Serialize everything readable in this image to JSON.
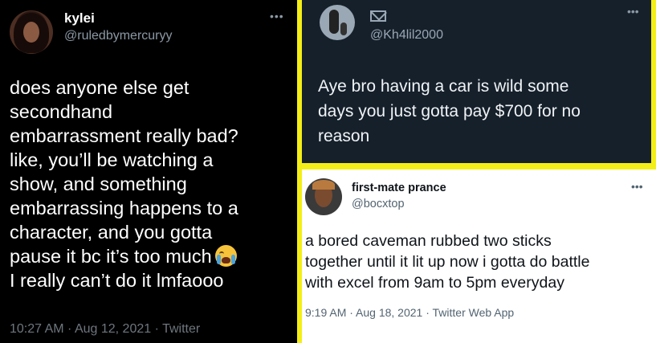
{
  "left_tweet": {
    "name": "kylei",
    "handle": "@ruledbymercuryy",
    "more_icon": "•••",
    "lines": [
      "does anyone else get",
      "secondhand",
      "embarrassment really bad?",
      "like, you’ll be watching a",
      "show, and something",
      "embarrassing happens to a",
      "character, and you gotta",
      "pause it bc it’s too much",
      "I really can’t do it lmfaooo"
    ],
    "emoji": "loudly-crying-face-icon",
    "timestamp": "10:27 AM · Aug 12, 2021 · Twitter"
  },
  "top_right_tweet": {
    "handle": "@Kh4lil2000",
    "more_icon": "•••",
    "lines": [
      "Aye bro having a car is wild some",
      "days you just gotta pay $700 for no",
      "reason"
    ]
  },
  "bottom_right_tweet": {
    "name": "first-mate prance",
    "handle": "@bocxtop",
    "more_icon": "•••",
    "lines": [
      "a bored caveman rubbed two sticks",
      "together until it lit up now i gotta do battle",
      "with excel from 9am to 5pm everyday"
    ],
    "timestamp": "9:19 AM · Aug 18, 2021 · Twitter Web App"
  },
  "colors": {
    "divider": "#f4ee18",
    "dark_bg": "#000000",
    "dim_bg": "#15202b",
    "light_bg": "#ffffff"
  }
}
